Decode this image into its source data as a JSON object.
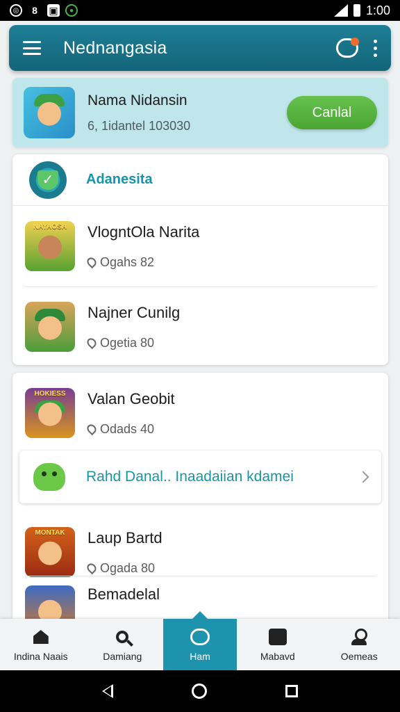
{
  "status_bar": {
    "time": "1:00"
  },
  "app_bar": {
    "title": "Nednangasia"
  },
  "profile": {
    "name": "Nama Nidansin",
    "subtitle": "6, 1idantel 103030",
    "action_label": "Canlal"
  },
  "section": {
    "title": "Adanesita"
  },
  "list_1": [
    {
      "title": "VlogntOla Narita",
      "subtitle": "Ogahs 82",
      "thumb_label": "NAYAOSA"
    },
    {
      "title": "Najner Cunilg",
      "subtitle": "Ogetia 80"
    }
  ],
  "list_2": [
    {
      "title": "Valan Geobit",
      "subtitle": "Odads 40",
      "thumb_label": "HOKIESS"
    },
    {
      "title": "Laup Bartd",
      "subtitle": "Ogada 80",
      "thumb_label": "MONTAK"
    },
    {
      "title": "Bemadelal"
    }
  ],
  "banner": {
    "text": "Rahd Danal.. Inaadaiian kdamei"
  },
  "bottom_nav": [
    {
      "label": "Indina Naais"
    },
    {
      "label": "Damiang"
    },
    {
      "label": "Ham"
    },
    {
      "label": "Mabavd"
    },
    {
      "label": "Oemeas"
    }
  ],
  "colors": {
    "accent": "#1e93ad",
    "header": "#13657a",
    "button": "#4aa533",
    "highlight_card": "#bfe6ea"
  }
}
